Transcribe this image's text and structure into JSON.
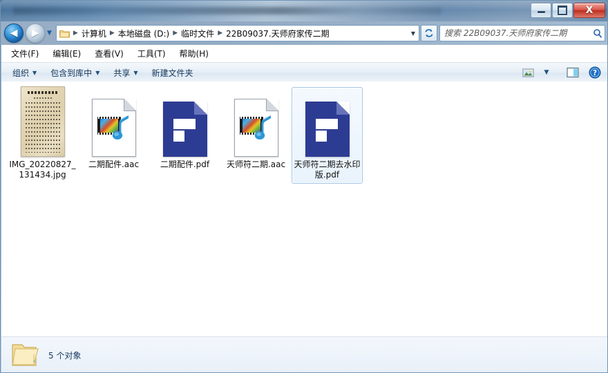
{
  "window": {
    "title_bar_text": "",
    "controls": {
      "minimize": "minimize-button",
      "maximize": "maximize-button",
      "close_label": "X"
    }
  },
  "nav": {
    "back_arrow": "◀",
    "forward_arrow": "▶",
    "history_arrow": "▼"
  },
  "address": {
    "crumbs": [
      {
        "label": "计算机"
      },
      {
        "label": "本地磁盘 (D:)"
      },
      {
        "label": "临时文件"
      },
      {
        "label": "22B09037.天师府家传二期"
      }
    ],
    "separator": "▶",
    "dropdown_arrow": "▼",
    "refresh_label": "↯"
  },
  "search": {
    "placeholder": "搜索 22B09037.天师府家传二期",
    "value": ""
  },
  "menubar": {
    "items": [
      {
        "text": "文件(F)"
      },
      {
        "text": "编辑(E)"
      },
      {
        "text": "查看(V)"
      },
      {
        "text": "工具(T)"
      },
      {
        "text": "帮助(H)"
      }
    ]
  },
  "toolbar": {
    "items": [
      {
        "label": "组织",
        "caret": "▼"
      },
      {
        "label": "包含到库中",
        "caret": "▼"
      },
      {
        "label": "共享",
        "caret": "▼"
      },
      {
        "label": "新建文件夹",
        "caret": ""
      }
    ],
    "view_caret": "▼",
    "help_label": "?"
  },
  "files": [
    {
      "name": "IMG_20220827_131434.jpg",
      "icon": "image-thumbnail-icon",
      "selected": false
    },
    {
      "name": "二期配件.aac",
      "icon": "media-audio-icon",
      "selected": false
    },
    {
      "name": "二期配件.pdf",
      "icon": "pdf-icon",
      "selected": false
    },
    {
      "name": "天师符二期.aac",
      "icon": "media-audio-icon",
      "selected": false
    },
    {
      "name": "天师符二期去水印版.pdf",
      "icon": "pdf-icon",
      "selected": true
    }
  ],
  "status": {
    "text": "5 个对象",
    "icon": "open-folder-icon"
  },
  "colors": {
    "pdf_blue": "#2d3c93",
    "selection_border": "#a7c6e4",
    "accent_blue": "#1663ae",
    "close_red": "#bc2f20",
    "status_text": "#1b3b63"
  }
}
